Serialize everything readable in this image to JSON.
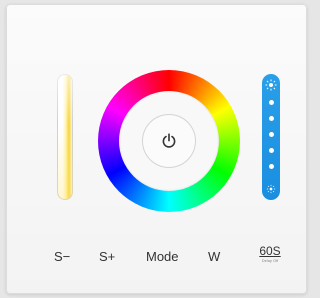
{
  "controls": {
    "s_minus": "S−",
    "s_plus": "S+",
    "mode": "Mode",
    "w": "W",
    "timer": "60S",
    "timer_sub": "Delay Off"
  },
  "icons": {
    "power": "power-icon",
    "sun": "sun-icon"
  },
  "colors": {
    "brightness_slider": "#1f95e4",
    "panel": "#f7f7f7"
  }
}
